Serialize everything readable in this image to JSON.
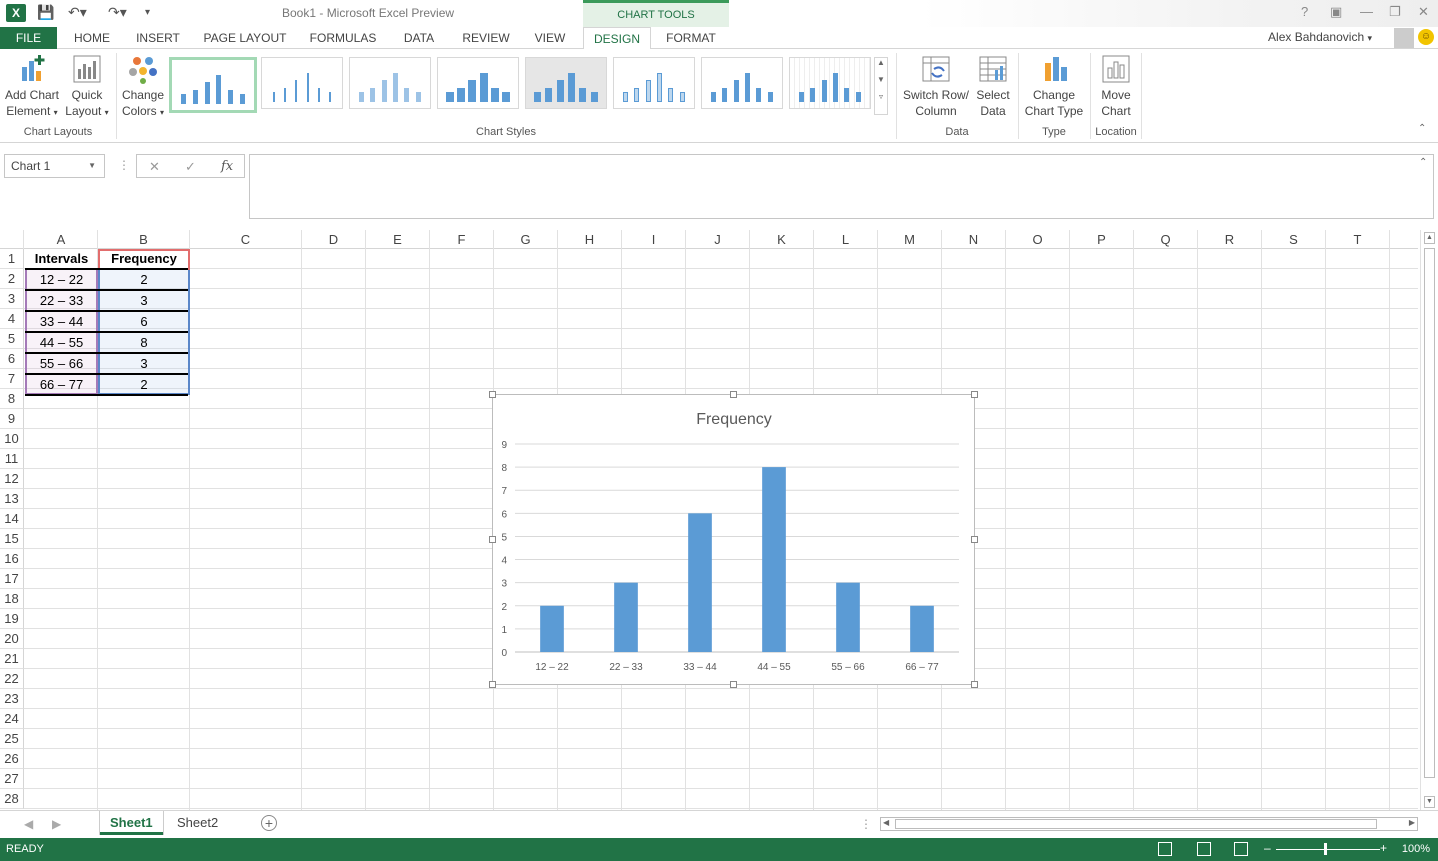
{
  "window": {
    "title": "Book1 - Microsoft Excel Preview",
    "contextual_tab_group": "CHART TOOLS",
    "user_name": "Alex Bahdanovich",
    "help": "?"
  },
  "tabs": [
    {
      "label": "FILE"
    },
    {
      "label": "HOME"
    },
    {
      "label": "INSERT"
    },
    {
      "label": "PAGE LAYOUT"
    },
    {
      "label": "FORMULAS"
    },
    {
      "label": "DATA"
    },
    {
      "label": "REVIEW"
    },
    {
      "label": "VIEW"
    },
    {
      "label": "DESIGN",
      "active": true
    },
    {
      "label": "FORMAT"
    }
  ],
  "ribbon": {
    "add_chart_element_1": "Add Chart",
    "add_chart_element_2": "Element",
    "quick_layout_1": "Quick",
    "quick_layout_2": "Layout",
    "change_colors_1": "Change",
    "change_colors_2": "Colors",
    "group_chart_layouts": "Chart Layouts",
    "group_chart_styles": "Chart Styles",
    "switch_row_col_1": "Switch Row/",
    "switch_row_col_2": "Column",
    "select_data_1": "Select",
    "select_data_2": "Data",
    "group_data": "Data",
    "change_chart_type_1": "Change",
    "change_chart_type_2": "Chart Type",
    "group_type": "Type",
    "move_chart_1": "Move",
    "move_chart_2": "Chart",
    "group_location": "Location"
  },
  "formula_bar": {
    "name_box": "Chart 1",
    "fx": "fx",
    "cancel": "✕",
    "enter": "✓",
    "value": ""
  },
  "columns": [
    "A",
    "B",
    "C",
    "D",
    "E",
    "F",
    "G",
    "H",
    "I",
    "J",
    "K",
    "L",
    "M",
    "N",
    "O",
    "P",
    "Q",
    "R",
    "S",
    "T"
  ],
  "rows": [
    "1",
    "2",
    "3",
    "4",
    "5",
    "6",
    "7",
    "8",
    "9",
    "10",
    "11",
    "12",
    "13",
    "14",
    "15",
    "16",
    "17",
    "18",
    "19",
    "20",
    "21",
    "22",
    "23",
    "24",
    "25",
    "26",
    "27",
    "28"
  ],
  "table": {
    "header_a": "Intervals",
    "header_b": "Frequency",
    "rows": [
      {
        "interval": "12 – 22",
        "frequency": "2"
      },
      {
        "interval": "22 – 33",
        "frequency": "3"
      },
      {
        "interval": "33 – 44",
        "frequency": "6"
      },
      {
        "interval": "44 – 55",
        "frequency": "8"
      },
      {
        "interval": "55 – 66",
        "frequency": "3"
      },
      {
        "interval": "66 – 77",
        "frequency": "2"
      }
    ]
  },
  "chart_data": {
    "type": "bar",
    "title": "Frequency",
    "categories": [
      "12 – 22",
      "22 – 33",
      "33 – 44",
      "44 – 55",
      "55 – 66",
      "66 – 77"
    ],
    "values": [
      2,
      3,
      6,
      8,
      3,
      2
    ],
    "ylim": [
      0,
      9
    ],
    "yticks": [
      0,
      1,
      2,
      3,
      4,
      5,
      6,
      7,
      8,
      9
    ],
    "xlabel": "",
    "ylabel": "",
    "grid": true,
    "legend": "none",
    "color": "#5b9bd5"
  },
  "sheets": [
    {
      "label": "Sheet1",
      "active": true
    },
    {
      "label": "Sheet2",
      "active": false
    }
  ],
  "status": {
    "text": "READY",
    "zoom": "100%"
  },
  "colors": {
    "accent": "#217346",
    "bar": "#5b9bd5"
  }
}
